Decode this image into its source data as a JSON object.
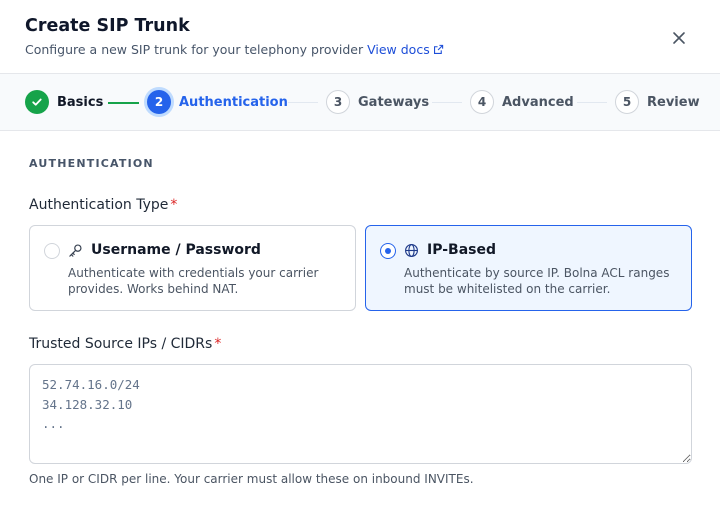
{
  "dialog": {
    "title": "Create SIP Trunk",
    "subtitle": "Configure a new SIP trunk for your telephony provider",
    "docs_link": "View docs",
    "icons": {
      "close": "close-icon",
      "external": "external-link-icon"
    }
  },
  "stepper": {
    "current_step": 2,
    "steps": [
      {
        "number": "1",
        "label": "Basics",
        "state": "done"
      },
      {
        "number": "2",
        "label": "Authentication",
        "state": "active"
      },
      {
        "number": "3",
        "label": "Gateways",
        "state": "todo"
      },
      {
        "number": "4",
        "label": "Advanced",
        "state": "todo"
      },
      {
        "number": "5",
        "label": "Review",
        "state": "todo"
      }
    ]
  },
  "section": {
    "heading": "AUTHENTICATION"
  },
  "auth_type": {
    "label": "Authentication Type",
    "required_mark": "*",
    "selected": "ip-based",
    "options": [
      {
        "id": "username-password",
        "title": "Username / Password",
        "description": "Authenticate with credentials your carrier provides. Works behind NAT.",
        "icon": "key-icon"
      },
      {
        "id": "ip-based",
        "title": "IP-Based",
        "description": "Authenticate by source IP. Bolna ACL ranges must be whitelisted on the carrier.",
        "icon": "globe-icon"
      }
    ]
  },
  "trusted_ips": {
    "label": "Trusted Source IPs / CIDRs",
    "required_mark": "*",
    "placeholder": "52.74.16.0/24\n34.128.32.10\n...",
    "value": "",
    "helper": "One IP or CIDR per line. Your carrier must allow these on inbound INVITEs."
  },
  "colors": {
    "primary": "#2563eb",
    "success": "#16a34a",
    "required": "#dc2626",
    "selected_bg": "#eff6ff"
  }
}
